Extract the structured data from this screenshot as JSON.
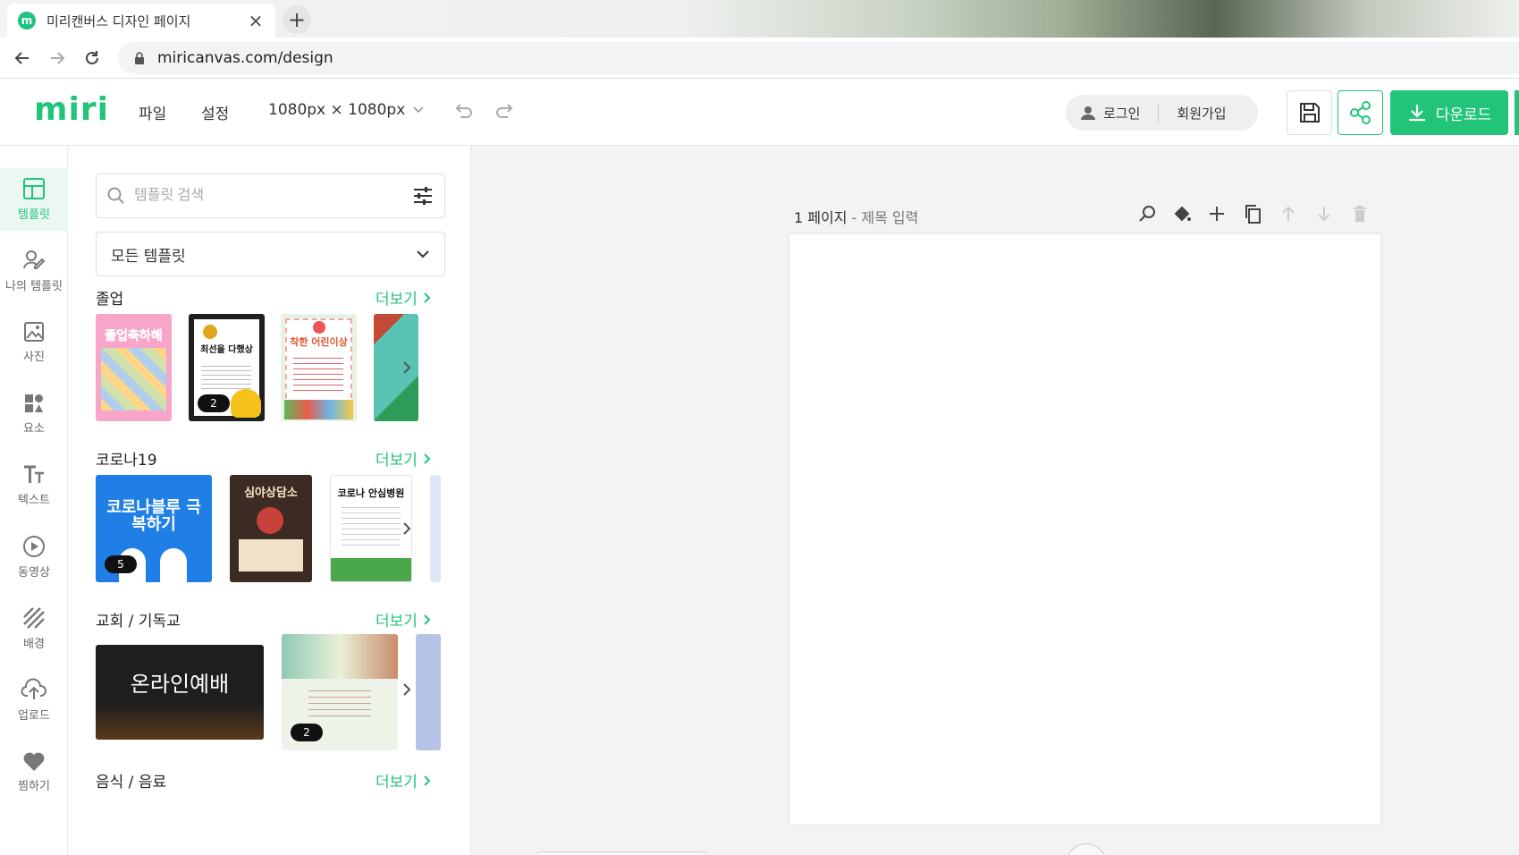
{
  "browser": {
    "tab_title": "미리캔버스 디자인 페이지",
    "favicon_letter": "m",
    "url": "miricanvas.com/design",
    "new_tab": "+",
    "close_tab": "×"
  },
  "header": {
    "logo": "miri",
    "menu": [
      "파일",
      "설정"
    ],
    "canvas_size": "1080px × 1080px",
    "login": "로그인",
    "signup": "회원가입",
    "download": "다운로드"
  },
  "rail": [
    {
      "label": "템플릿",
      "icon": "template-icon",
      "active": true
    },
    {
      "label": "나의 템플릿",
      "icon": "my-template-icon"
    },
    {
      "label": "사진",
      "icon": "photo-icon"
    },
    {
      "label": "요소",
      "icon": "elements-icon"
    },
    {
      "label": "텍스트",
      "icon": "text-icon"
    },
    {
      "label": "동영상",
      "icon": "video-icon"
    },
    {
      "label": "배경",
      "icon": "background-icon"
    },
    {
      "label": "업로드",
      "icon": "upload-icon"
    },
    {
      "label": "찜하기",
      "icon": "heart-icon"
    }
  ],
  "panel": {
    "search_placeholder": "템플릿 검색",
    "category": "모든 템플릿",
    "more_label": "더보기",
    "sections": [
      {
        "title": "졸업",
        "thumbs": [
          {
            "text": "졸업축하해",
            "color": "#f7a6c9"
          },
          {
            "text": "최선을 다했상",
            "color": "#1f1f1f",
            "badge": "2"
          },
          {
            "text": "착한 어린이상",
            "color": "#e7f1e4"
          },
          {
            "text": "",
            "color": "#52b6a8"
          }
        ]
      },
      {
        "title": "코로나19",
        "thumbs": [
          {
            "text": "코로나블루 극복하기",
            "color": "#1f7fe6",
            "badge": "5"
          },
          {
            "text": "심야상담소",
            "color": "#3b2b22"
          },
          {
            "text": "코로나 안심병원",
            "color": "#ffffff"
          },
          {
            "text": "",
            "color": "#dfe6f5"
          }
        ]
      },
      {
        "title": "교회 / 기독교",
        "thumbs": [
          {
            "text": "온라인예배",
            "color": "#1e1e1e"
          },
          {
            "text": "",
            "color": "#eef3ea",
            "badge": "2"
          },
          {
            "text": "",
            "color": "#b6c3e6"
          }
        ]
      },
      {
        "title": "음식 / 음료",
        "thumbs": []
      }
    ]
  },
  "workspace": {
    "page_number": "1 페이지",
    "page_title_placeholder": "- 제목 입력"
  }
}
